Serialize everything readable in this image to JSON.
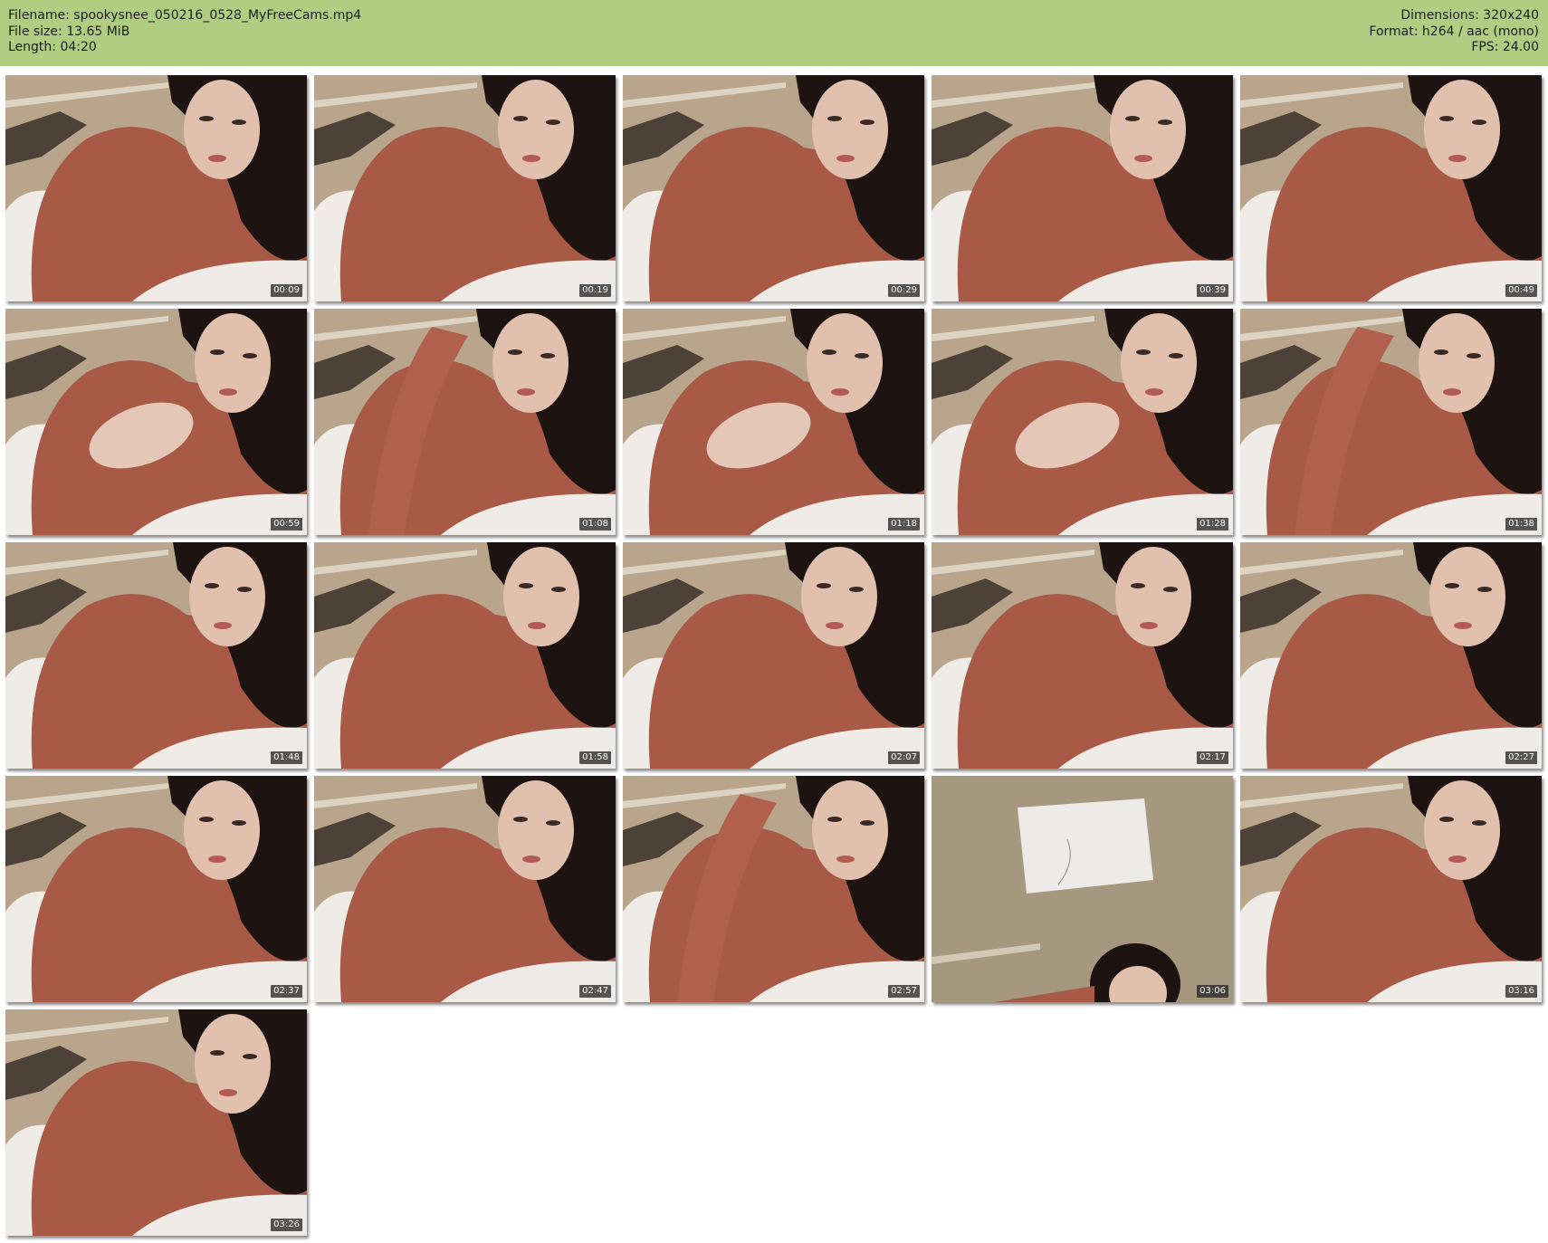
{
  "header": {
    "filename": "Filename: spookysnee_050216_0528_MyFreeCams.mp4",
    "filesize": "File size: 13.65 MiB",
    "length": "Length: 04:20",
    "dimensions": "Dimensions: 320x240",
    "format": "Format: h264 / aac (mono)",
    "fps": "FPS: 24.00"
  },
  "colors": {
    "header_bg": "#b0cd82",
    "wall": "#b8a58c",
    "sweater": "#a85a47",
    "pillow": "#efece8",
    "hair": "#1d1412",
    "skin": "#e2c0ae"
  },
  "thumbnails": [
    {
      "time": "00:09",
      "scene": "person"
    },
    {
      "time": "00:19",
      "scene": "person"
    },
    {
      "time": "00:29",
      "scene": "person"
    },
    {
      "time": "00:39",
      "scene": "person"
    },
    {
      "time": "00:49",
      "scene": "person"
    },
    {
      "time": "00:59",
      "scene": "person-hand"
    },
    {
      "time": "01:08",
      "scene": "person-arm"
    },
    {
      "time": "01:18",
      "scene": "person-hand"
    },
    {
      "time": "01:28",
      "scene": "person-hand"
    },
    {
      "time": "01:38",
      "scene": "person-arm"
    },
    {
      "time": "01:48",
      "scene": "person"
    },
    {
      "time": "01:58",
      "scene": "person"
    },
    {
      "time": "02:07",
      "scene": "person"
    },
    {
      "time": "02:17",
      "scene": "person"
    },
    {
      "time": "02:27",
      "scene": "person"
    },
    {
      "time": "02:37",
      "scene": "person"
    },
    {
      "time": "02:47",
      "scene": "person"
    },
    {
      "time": "02:57",
      "scene": "person-arm"
    },
    {
      "time": "03:06",
      "scene": "wall"
    },
    {
      "time": "03:16",
      "scene": "person"
    },
    {
      "time": "03:26",
      "scene": "person"
    }
  ]
}
